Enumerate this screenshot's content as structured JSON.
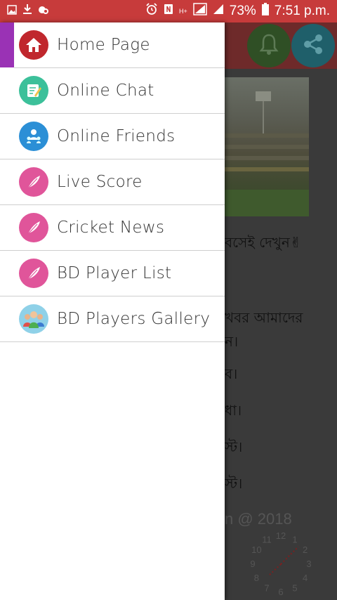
{
  "status_bar": {
    "battery_percent": "73%",
    "time": "7:51 p.m.",
    "left_icons": [
      "image-icon",
      "download-icon",
      "cloud-icon"
    ],
    "right_icons": [
      "alarm-icon",
      "nfc-icon",
      "hplus-icon",
      "signal-icon",
      "signal-icon",
      "battery-icon"
    ],
    "network_label": "H+"
  },
  "drawer": {
    "items": [
      {
        "label": "Home Page",
        "icon": "home-icon",
        "icon_color": "#c0272d"
      },
      {
        "label": "Online Chat",
        "icon": "chat-edit-icon",
        "icon_color": "#3cc09a"
      },
      {
        "label": "Online Friends",
        "icon": "friends-icon",
        "icon_color": "#2b8fd6"
      },
      {
        "label": "Live Score",
        "icon": "feather-icon",
        "icon_color": "#e0559a"
      },
      {
        "label": "Cricket News",
        "icon": "feather-icon",
        "icon_color": "#e0559a"
      },
      {
        "label": "BD Player List",
        "icon": "feather-icon",
        "icon_color": "#e0559a"
      },
      {
        "label": "BD Players Gallery",
        "icon": "people-group-icon",
        "icon_color": "#8fd1e8"
      }
    ],
    "accent_color": "#9a32b5"
  },
  "background": {
    "toolbar_color": "#c0392b",
    "lines": [
      {
        "text": "বসেই দেখুন✌"
      },
      {
        "text": "খবর আমাদের"
      },
      {
        "text": "ন।"
      },
      {
        "text": "ব।"
      },
      {
        "text": "ধা।"
      },
      {
        "text": "স্ট।"
      },
      {
        "text": "স্ট।"
      }
    ],
    "footer": "n @ 2018",
    "clock_numbers": [
      "12",
      "1",
      "2",
      "3",
      "4",
      "5",
      "6",
      "7",
      "8",
      "9",
      "10",
      "11"
    ]
  }
}
